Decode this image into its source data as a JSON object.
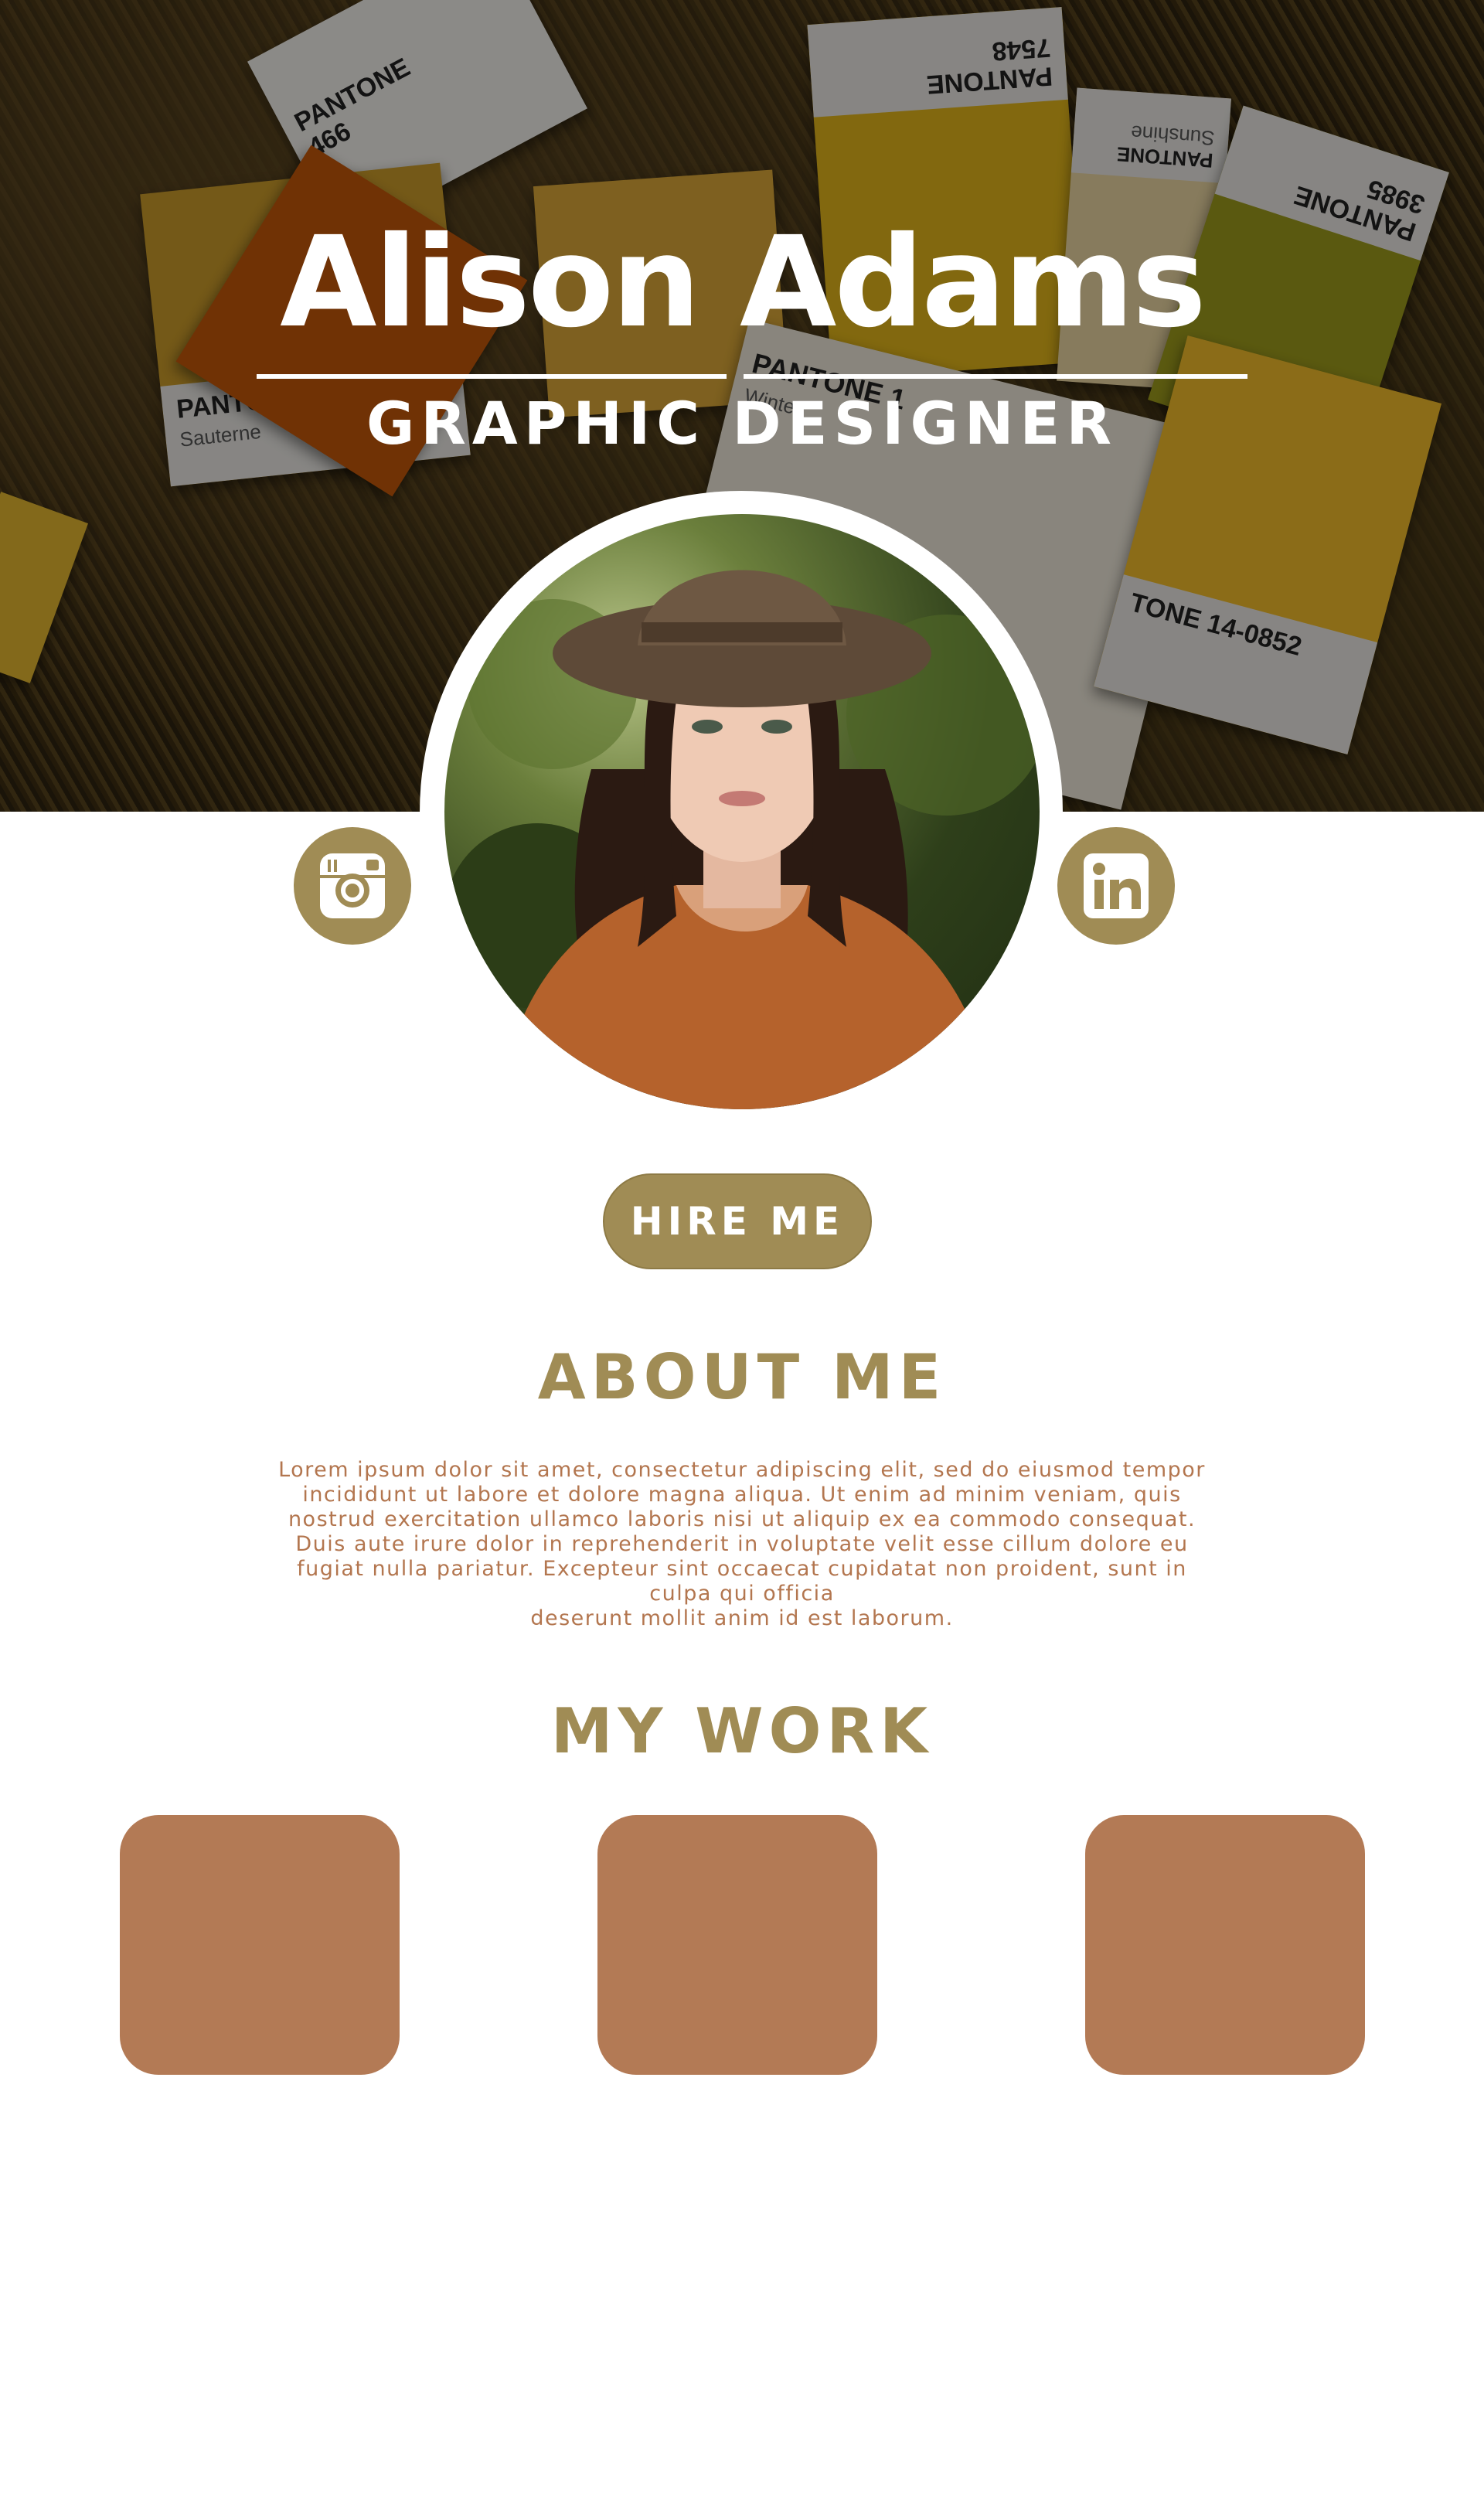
{
  "hero": {
    "name": "Alison Adams",
    "title": "GRAPHIC DESIGNER",
    "cards": [
      {
        "brand": "PANTONE",
        "code": "466"
      },
      {
        "brand": "PANTONE",
        "code": "7548"
      },
      {
        "brand": "PANTONE",
        "code": "Sunshine"
      },
      {
        "brand": "PANTONE",
        "code": "3985"
      },
      {
        "brand": "PANTONE",
        "code": "Sauterne"
      },
      {
        "brand": "PANTONE 1",
        "code": "Winter"
      },
      {
        "brand": "TONE 14-0852",
        "code": ""
      }
    ]
  },
  "social": {
    "instagram_icon": "instagram-icon",
    "linkedin_icon": "linkedin-icon"
  },
  "hire": {
    "label": "HIRE ME"
  },
  "about": {
    "heading": "ABOUT ME",
    "lines": [
      "Lorem ipsum dolor sit amet, consectetur adipiscing elit, sed do eiusmod tempor",
      "incididunt ut labore et dolore magna aliqua. Ut enim ad minim veniam, quis",
      "nostrud exercitation ullamco laboris nisi ut aliquip ex ea commodo consequat.",
      "Duis aute irure dolor in reprehenderit in voluptate velit esse cillum dolore eu",
      "fugiat nulla pariatur. Excepteur sint occaecat cupidatat non proident, sunt in",
      "culpa qui officia",
      "deserunt mollit anim id est laborum."
    ]
  },
  "work": {
    "heading": "MY WORK",
    "items": [
      "work-item-1",
      "work-item-2",
      "work-item-3"
    ]
  },
  "colors": {
    "accent": "#a08c55",
    "work_tile": "#b37a55",
    "body_text": "#b3764f"
  }
}
